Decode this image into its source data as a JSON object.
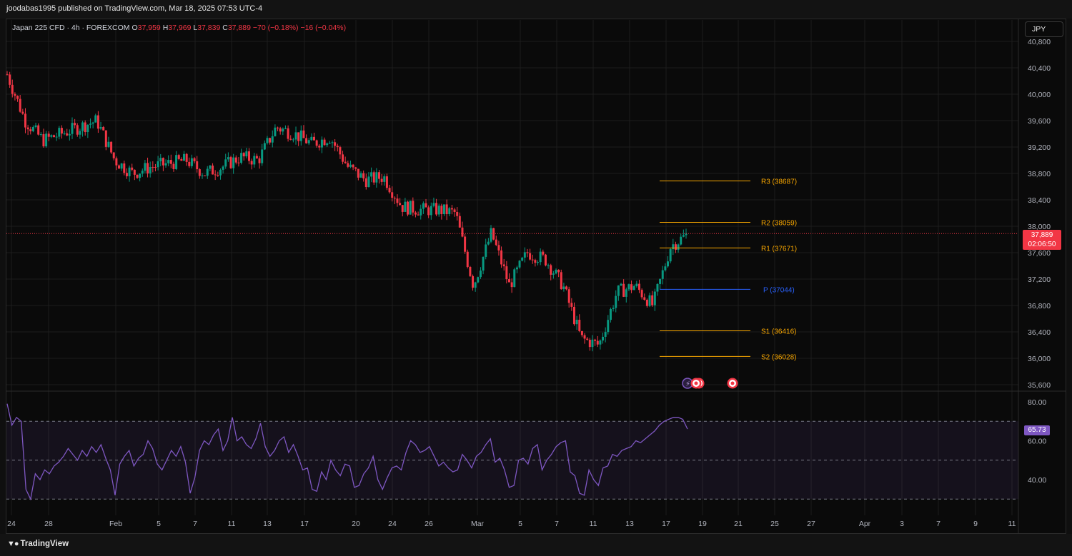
{
  "header": {
    "published": "joodabas1995 published on TradingView.com, Mar 18, 2025 07:53 UTC-4",
    "symbol": "Japan 225 CFD · 4h · FOREXCOM",
    "o_label": "O",
    "o_value": "37,959",
    "h_label": "H",
    "h_value": "37,969",
    "l_label": "L",
    "l_value": "37,839",
    "c_label": "C",
    "c_value": "37,889",
    "change": "−70 (−0.18%)",
    "volume": "−16 (−0.04%)"
  },
  "currency_button": "JPY",
  "footer": {
    "brand": "TradingView"
  },
  "price_tag": {
    "price": "37,889",
    "countdown": "02:06:50"
  },
  "rsi_tag": "65.73",
  "colors": {
    "up": "#089981",
    "down": "#f23645",
    "pivot_levels": "#f7a600",
    "pivot": "#2962ff",
    "rsi": "#7e57c2",
    "background": "#0a0a0a"
  },
  "icons": [
    "lightning-icon",
    "target-icon"
  ],
  "chart_data": [
    {
      "type": "candlestick",
      "title": "Japan 225 CFD · 4h · FOREXCOM",
      "ylim": [
        35500,
        40900
      ],
      "y_ticks": [
        "40,800",
        "40,400",
        "40,000",
        "39,600",
        "39,200",
        "38,800",
        "38,400",
        "38,000",
        "37,600",
        "37,200",
        "36,800",
        "36,400",
        "36,000",
        "35,600"
      ],
      "x_ticks": [
        "24",
        "28",
        "Feb",
        "5",
        "7",
        "11",
        "13",
        "17",
        "20",
        "24",
        "26",
        "Mar",
        "5",
        "7",
        "11",
        "13",
        "17",
        "19",
        "21",
        "25",
        "27",
        "Apr",
        "3",
        "7",
        "9",
        "11"
      ],
      "close_path": [
        [
          "24",
          40300
        ],
        [
          "25",
          39600
        ],
        [
          "28",
          39300
        ],
        [
          "29",
          39400
        ],
        [
          "30",
          39500
        ],
        [
          "31",
          39600
        ],
        [
          "Feb 1",
          39000
        ],
        [
          "Feb 3",
          38800
        ],
        [
          "Feb 4",
          38900
        ],
        [
          "Feb 5",
          38950
        ],
        [
          "Feb 6",
          39000
        ],
        [
          "Feb 7",
          38800
        ],
        [
          "Feb 10",
          38900
        ],
        [
          "Feb 11",
          39050
        ],
        [
          "Feb 12",
          39000
        ],
        [
          "Feb 13",
          39500
        ],
        [
          "Feb 14",
          39400
        ],
        [
          "Feb 17",
          39250
        ],
        [
          "Feb 18",
          39350
        ],
        [
          "Feb 19",
          38900
        ],
        [
          "Feb 20",
          38700
        ],
        [
          "Feb 21",
          38750
        ],
        [
          "Feb 24",
          38300
        ],
        [
          "Feb 25",
          38250
        ],
        [
          "Feb 26",
          38250
        ],
        [
          "Feb 27",
          38200
        ],
        [
          "Feb 28",
          37100
        ],
        [
          "Mar 3",
          37900
        ],
        [
          "Mar 4",
          37100
        ],
        [
          "Mar 5",
          37600
        ],
        [
          "Mar 6",
          37500
        ],
        [
          "Mar 7",
          37100
        ],
        [
          "Mar 10",
          36300
        ],
        [
          "Mar 11",
          36200
        ],
        [
          "Mar 12",
          37000
        ],
        [
          "Mar 13",
          37100
        ],
        [
          "Mar 14",
          36800
        ],
        [
          "Mar 17",
          37700
        ],
        [
          "Mar 18",
          37889
        ]
      ],
      "last_price": 37889,
      "pivot_levels": [
        {
          "label": "R3 (38687)",
          "value": 38687
        },
        {
          "label": "R2 (38059)",
          "value": 38059
        },
        {
          "label": "R1 (37671)",
          "value": 37671
        },
        {
          "label": "P (37044)",
          "value": 37044
        },
        {
          "label": "S1 (36416)",
          "value": 36416
        },
        {
          "label": "S2 (36028)",
          "value": 36028
        }
      ]
    },
    {
      "type": "line",
      "title": "RSI",
      "ylim": [
        27,
        83
      ],
      "y_ticks": [
        "80.00",
        "60.00",
        "40.00"
      ],
      "bands": [
        70,
        50,
        30
      ],
      "last_value": 65.73,
      "values": [
        79,
        68,
        72,
        70,
        35,
        30,
        43,
        40,
        45,
        43,
        47,
        49,
        52,
        56,
        53,
        50,
        55,
        52,
        57,
        54,
        58,
        51,
        45,
        32,
        48,
        52,
        55,
        47,
        51,
        53,
        60,
        56,
        48,
        45,
        50,
        55,
        52,
        57,
        49,
        33,
        41,
        55,
        60,
        58,
        63,
        66,
        55,
        60,
        72,
        60,
        62,
        58,
        56,
        61,
        69,
        57,
        52,
        55,
        60,
        62,
        54,
        58,
        52,
        45,
        46,
        35,
        34,
        44,
        40,
        50,
        45,
        42,
        48,
        47,
        36,
        37,
        43,
        46,
        52,
        40,
        35,
        41,
        46,
        47,
        45,
        54,
        60,
        58,
        54,
        55,
        57,
        52,
        47,
        49,
        46,
        44,
        45,
        53,
        50,
        46,
        52,
        54,
        58,
        61,
        49,
        51,
        45,
        36,
        37,
        50,
        51,
        48,
        56,
        58,
        45,
        50,
        53,
        57,
        59,
        60,
        44,
        42,
        33,
        32,
        45,
        40,
        37,
        46,
        47,
        53,
        52,
        55,
        56,
        57,
        60,
        59,
        61,
        63,
        65,
        68,
        70,
        71,
        72,
        72,
        71,
        66
      ],
      "last_date": "Mar 18"
    }
  ]
}
